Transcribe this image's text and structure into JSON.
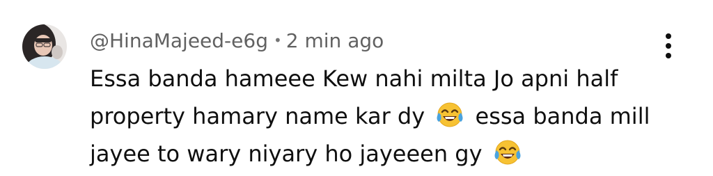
{
  "comment": {
    "author": "@HinaMajeed-e6g",
    "separator": "•",
    "time": "2 min ago",
    "lines": [
      {
        "text_before": "Essa banda hameee Kew nahi milta Jo apni half",
        "emoji": "",
        "text_after": ""
      },
      {
        "text_before": "property hamary name kar dy",
        "emoji": "face-with-tears-of-joy",
        "text_after": "essa banda mill"
      },
      {
        "text_before": "jayee to wary niyary ho jayeeen gy",
        "emoji": "face-with-tears-of-joy",
        "text_after": ""
      }
    ]
  },
  "icons": {
    "avatar": "profile-photo",
    "more": "vertical-ellipsis-icon",
    "emoji": "face-with-tears-of-joy"
  },
  "colors": {
    "meta_text": "#616161",
    "body_text": "#0f0f0f",
    "background": "#ffffff",
    "emoji_face": "#f7c233",
    "emoji_tears": "#4aa3df"
  }
}
